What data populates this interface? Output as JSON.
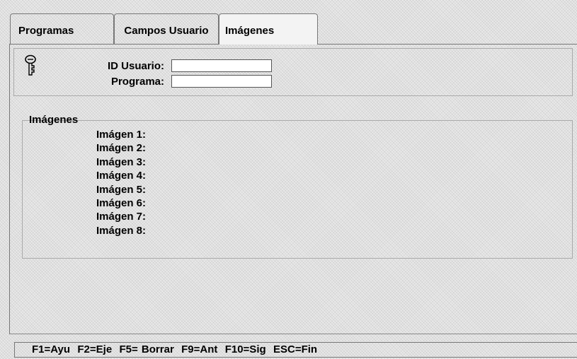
{
  "tabs": [
    {
      "label": "Programas"
    },
    {
      "label": "Campos Usuario"
    },
    {
      "label": "Imágenes"
    }
  ],
  "form": {
    "icon": "key-icon",
    "id_usuario_label": "ID Usuario:",
    "id_usuario_value": "",
    "programa_label": "Programa:",
    "programa_value": ""
  },
  "imagenes": {
    "title": "Imágenes",
    "items": [
      "Imágen 1:",
      "Imágen 2:",
      "Imágen 3:",
      "Imágen 4:",
      "Imágen 5:",
      "Imágen 6:",
      "Imágen 7:",
      "Imágen 8:"
    ]
  },
  "status_bar": {
    "text": "F1=Ayu  F2=Eje  F5= Borrar  F9=Ant  F10=Sig  ESC=Fin"
  }
}
